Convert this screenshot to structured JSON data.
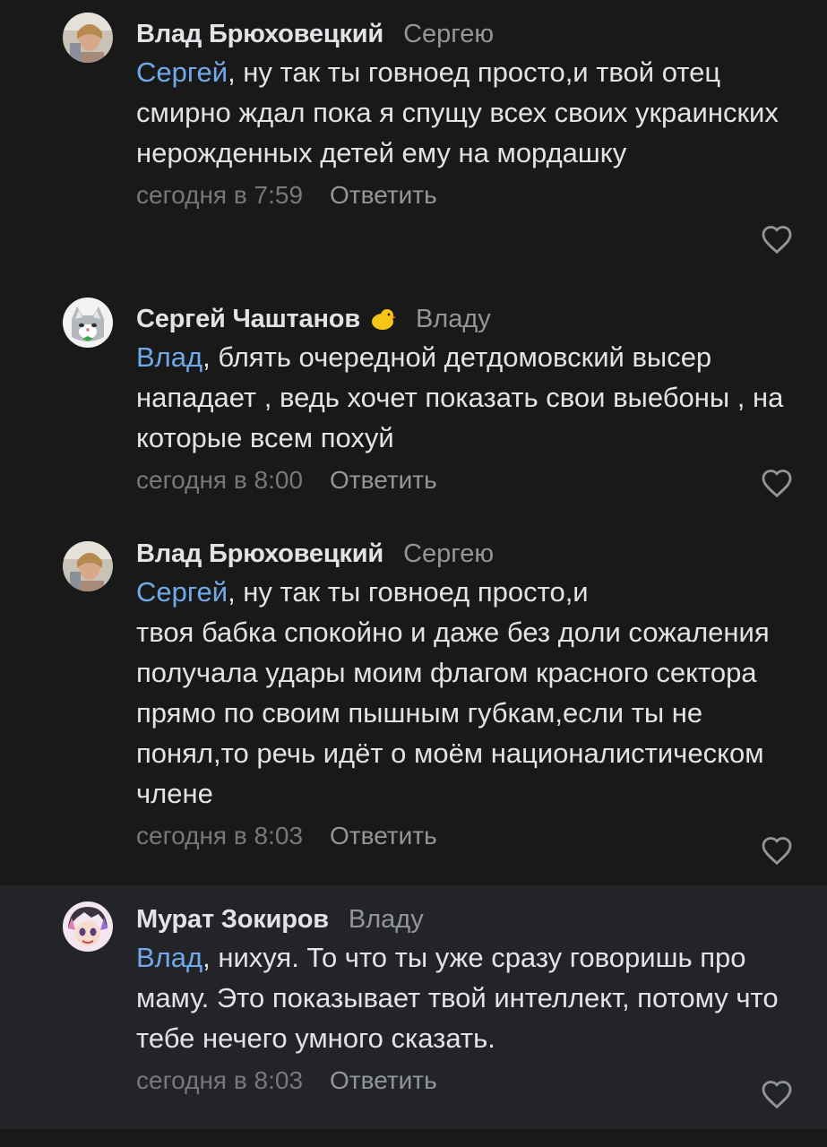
{
  "comments": [
    {
      "author": "Влад Брюховецкий",
      "reply_to": "Сергею",
      "mention": "Сергей",
      "text": ", ну так ты говноед просто,и твой отец смирно ждал пока я спущу всех своих украинских нерожденных детей ему на мордашку",
      "time": "сегодня в 7:59",
      "reply_label": "Ответить"
    },
    {
      "author": "Сергей Чаштанов",
      "reply_to": "Владу",
      "mention": "Влад",
      "text": ", блять очередной детдомовский высер нападает , ведь хочет показать свои выебоны , на которые всем похуй",
      "time": "сегодня в 8:00",
      "reply_label": "Ответить"
    },
    {
      "author": "Влад Брюховецкий",
      "reply_to": "Сергею",
      "mention": "Сергей",
      "text": ", ну так ты говноед просто,и\nтвоя бабка спокойно и даже без доли сожаления получала удары моим флагом красного сектора прямо по своим пышным губкам,если ты не понял,то речь идёт о моём националистическом члене",
      "time": "сегодня в 8:03",
      "reply_label": "Ответить"
    },
    {
      "author": "Мурат Зокиров",
      "reply_to": "Владу",
      "mention": "Влад",
      "text": ", нихуя. То что ты уже сразу говоришь про маму. Это показывает твой интеллект, потому что тебе нечего умного сказать.",
      "time": "сегодня в 8:03",
      "reply_label": "Ответить"
    }
  ],
  "colors": {
    "background": "#19191a",
    "highlight_background": "#222427",
    "mention": "#71aaeb",
    "text": "#e1e3e6",
    "muted": "#76787a"
  },
  "icons": [
    "avatar-photo",
    "avatar-cat",
    "duck-emoji",
    "avatar-anime",
    "heart-icon"
  ]
}
